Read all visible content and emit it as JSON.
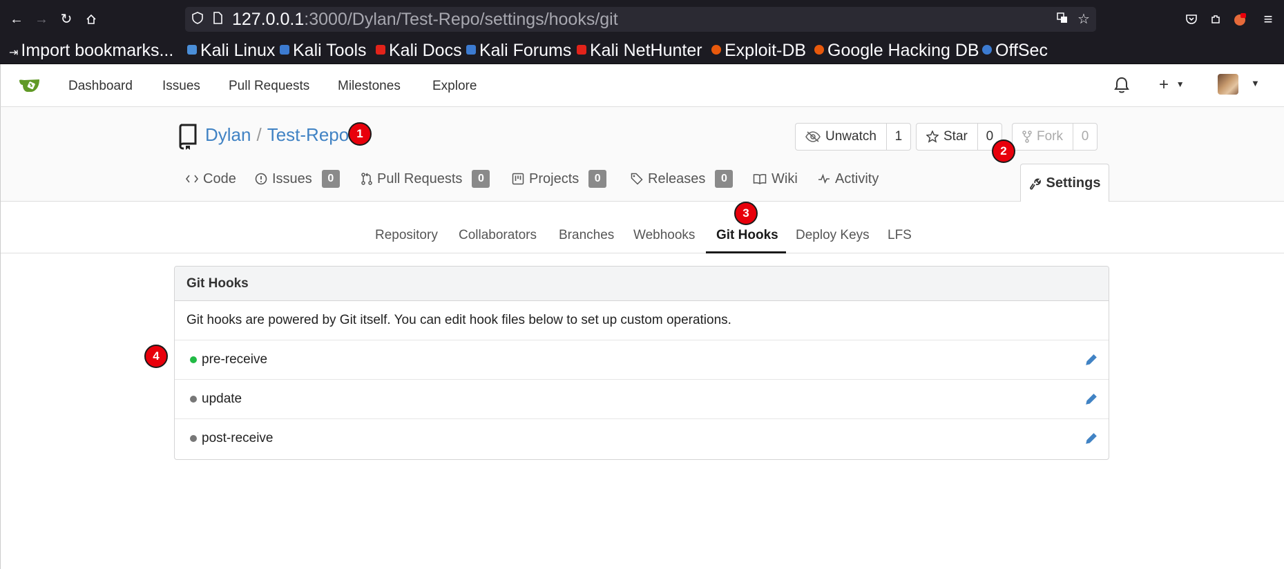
{
  "browser": {
    "url_host": "127.0.0.1",
    "url_rest": ":3000/Dylan/Test-Repo/settings/hooks/git",
    "bookmarks": [
      {
        "label": "Import bookmarks...",
        "color": "#fbfbfe"
      },
      {
        "label": "Kali Linux",
        "color": "#4a8ed8"
      },
      {
        "label": "Kali Tools",
        "color": "#3c7bd1"
      },
      {
        "label": "Kali Docs",
        "color": "#e2231a"
      },
      {
        "label": "Kali Forums",
        "color": "#3c7bd1"
      },
      {
        "label": "Kali NetHunter",
        "color": "#e2231a"
      },
      {
        "label": "Exploit-DB",
        "color": "#e8590c"
      },
      {
        "label": "Google Hacking DB",
        "color": "#e8590c"
      },
      {
        "label": "OffSec",
        "color": "#3c7bd1"
      }
    ]
  },
  "topnav": {
    "items": [
      "Dashboard",
      "Issues",
      "Pull Requests",
      "Milestones",
      "Explore"
    ]
  },
  "repo": {
    "owner": "Dylan",
    "sep": "/",
    "name": "Test-Repo",
    "watch_label": "Unwatch",
    "watch_count": "1",
    "star_label": "Star",
    "star_count": "0",
    "fork_label": "Fork",
    "fork_count": "0",
    "tabs": {
      "code": "Code",
      "issues": "Issues",
      "issues_count": "0",
      "pulls": "Pull Requests",
      "pulls_count": "0",
      "projects": "Projects",
      "projects_count": "0",
      "releases": "Releases",
      "releases_count": "0",
      "wiki": "Wiki",
      "activity": "Activity",
      "settings": "Settings"
    }
  },
  "settings_tabs": [
    "Repository",
    "Collaborators",
    "Branches",
    "Webhooks",
    "Git Hooks",
    "Deploy Keys",
    "LFS"
  ],
  "hooks": {
    "title": "Git Hooks",
    "description": "Git hooks are powered by Git itself. You can edit hook files below to set up custom operations.",
    "items": [
      {
        "name": "pre-receive",
        "active": true
      },
      {
        "name": "update",
        "active": false
      },
      {
        "name": "post-receive",
        "active": false
      }
    ]
  },
  "markers": [
    "1",
    "2",
    "3",
    "4"
  ],
  "colors": {
    "link": "#4183c4",
    "active_dot": "#21ba45",
    "inactive_dot": "#777777",
    "marker": "#e8000b",
    "edit_icon": "#4183c4"
  }
}
